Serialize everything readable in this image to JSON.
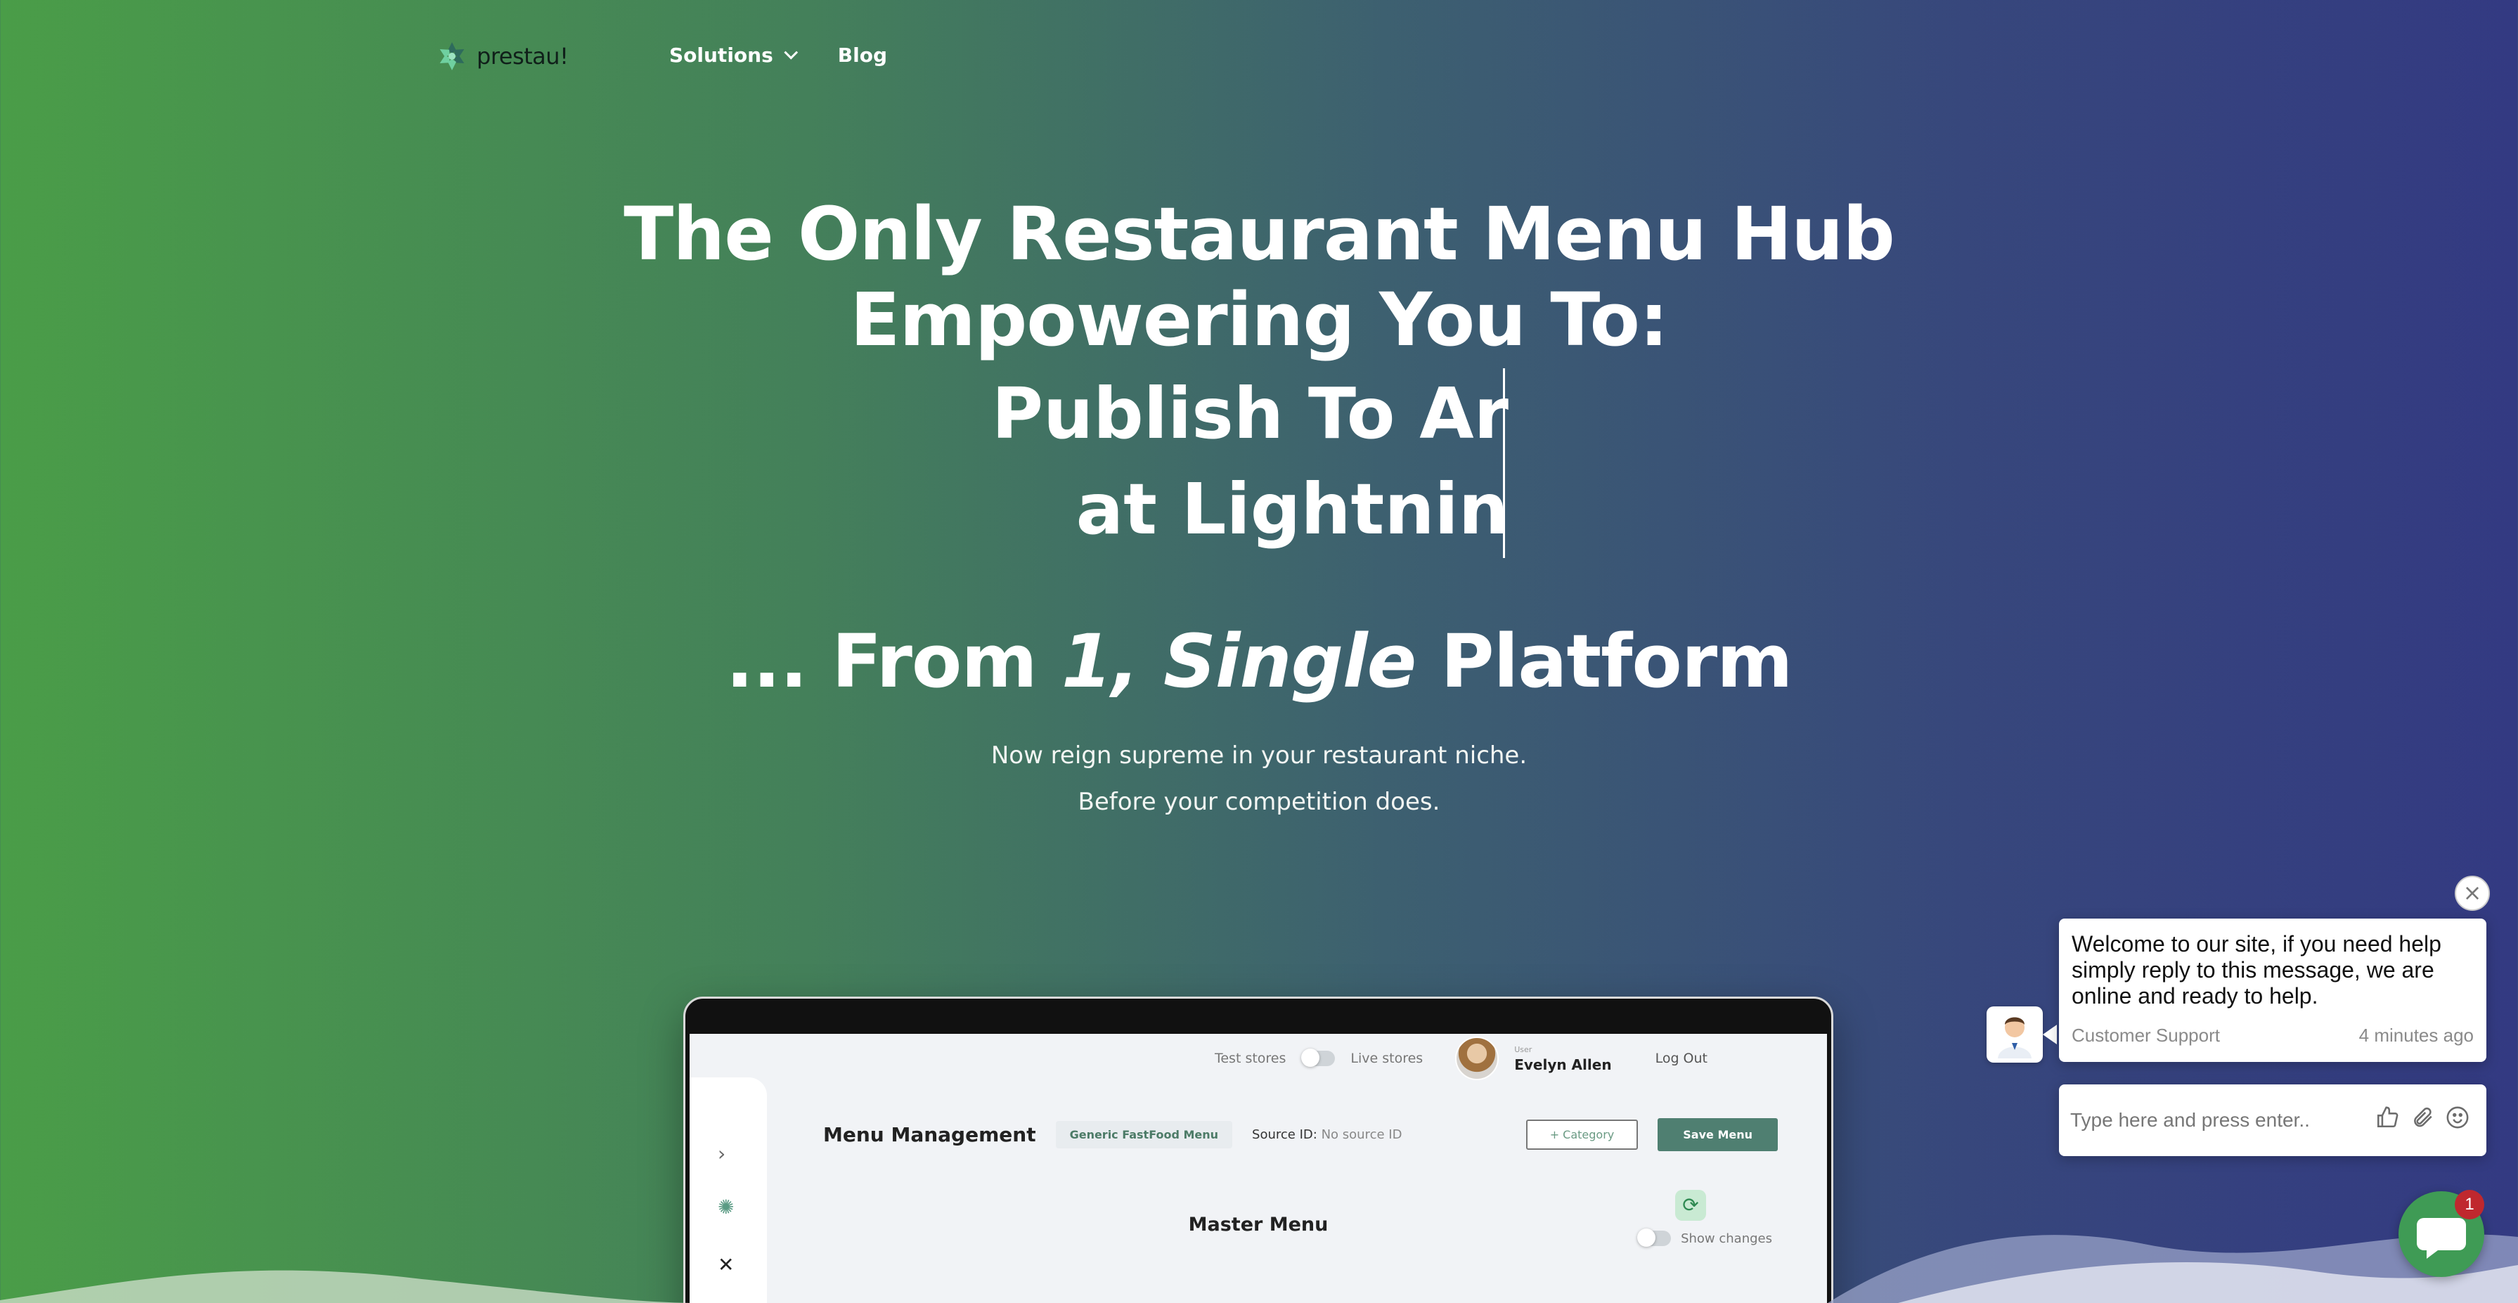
{
  "brand": {
    "name": "prestau!"
  },
  "nav": {
    "items": [
      {
        "label": "Solutions",
        "has_dropdown": true
      },
      {
        "label": "Blog",
        "has_dropdown": false
      }
    ]
  },
  "hero": {
    "title_line1": "The Only Restaurant Menu Hub",
    "title_line2": "Empowering You To:",
    "typewriter_line1": "Publish To Ar",
    "typewriter_line2": "at Lightnin",
    "tagline_pre": "... From ",
    "tagline_italic": "1, Single",
    "tagline_post": " Platform",
    "subtitle_line1": "Now reign supreme in your restaurant niche.",
    "subtitle_line2": "Before your competition does."
  },
  "mockup": {
    "test_stores_label": "Test stores",
    "live_stores_label": "Live stores",
    "user_caption": "User",
    "user_name": "Evelyn Allen",
    "logout_label": "Log Out",
    "page_title": "Menu Management",
    "menu_select": "Generic FastFood Menu",
    "source_label": "Source ID:",
    "source_value": "No source ID",
    "add_category_label": "+ Category",
    "save_menu_label": "Save Menu",
    "master_menu_label": "Master Menu",
    "show_changes_label": "Show changes"
  },
  "chat": {
    "message": "Welcome to our site, if you need help simply reply to this message, we are online and ready to help.",
    "agent_name": "Customer Support",
    "time": "4 minutes ago",
    "input_placeholder": "Type here and press enter..",
    "unread_count": "1"
  },
  "colors": {
    "gradient_left": "#4a9d48",
    "gradient_right": "#333a82",
    "chat_green": "#3f9b55",
    "save_button": "#4f7f71"
  }
}
